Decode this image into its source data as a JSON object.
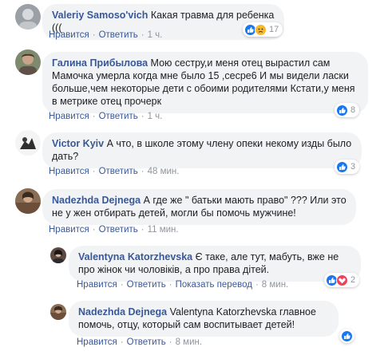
{
  "comments": [
    {
      "author": "Valeriy Samoso'vich",
      "text": "Какая травма для ребенка (((",
      "like": "Нравится",
      "reply": "Ответить",
      "time": "1 ч.",
      "reactions_count": "17",
      "reaction_icons": [
        "like-icon",
        "sad-icon"
      ]
    },
    {
      "author": "Галина Прибылова",
      "text": "Мою сестру,и меня отец вырастил сам Мамочка умерла когда мне было 15 ,сесре6 И мы видели ласки больше,чем некоторые дети с обоими родителями Кстати,у меня в метрике отец прочерк",
      "like": "Нравится",
      "reply": "Ответить",
      "time": "1 ч.",
      "reactions_count": "8",
      "reaction_icons": [
        "like-icon"
      ]
    },
    {
      "author": "Victor Kyiv",
      "text": "А что, в школе этому члену опеки некому изды было дать?",
      "like": "Нравится",
      "reply": "Ответить",
      "time": "48 мин.",
      "reactions_count": "3",
      "reaction_icons": [
        "like-icon"
      ]
    },
    {
      "author": "Nadezhda Dejnega",
      "text": "А где же \" батьки мають право\" ??? Или это не у жен отбирать детей, могли бы помочь мужчине!",
      "like": "Нравится",
      "reply": "Ответить",
      "time": "11 мин."
    },
    {
      "author": "Valentyna Katorzhevska",
      "text": "Є таке, але тут, мабуть, вже не про жінок чи чоловіків, а про права дітей.",
      "like": "Нравится",
      "reply": "Ответить",
      "translate": "Показать перевод",
      "time": "8 мин.",
      "reactions_count": "2",
      "reaction_icons": [
        "like-icon",
        "love-icon"
      ]
    },
    {
      "author": "Nadezhda Dejnega",
      "text": "Valentyna Katorzhevska главное помочь, отцу, который сам воспитывает детей!",
      "like": "Нравится",
      "reply": "Ответить",
      "time": "8 мин.",
      "reactions_count": "",
      "reaction_icons": [
        "like-icon"
      ]
    }
  ],
  "colors": {
    "author": "#385898",
    "bubble": "#f2f3f5",
    "meta": "#90949c",
    "like_blue": "#1877f2",
    "love_red": "#f33e58",
    "sad_yellow": "#f7b928"
  }
}
